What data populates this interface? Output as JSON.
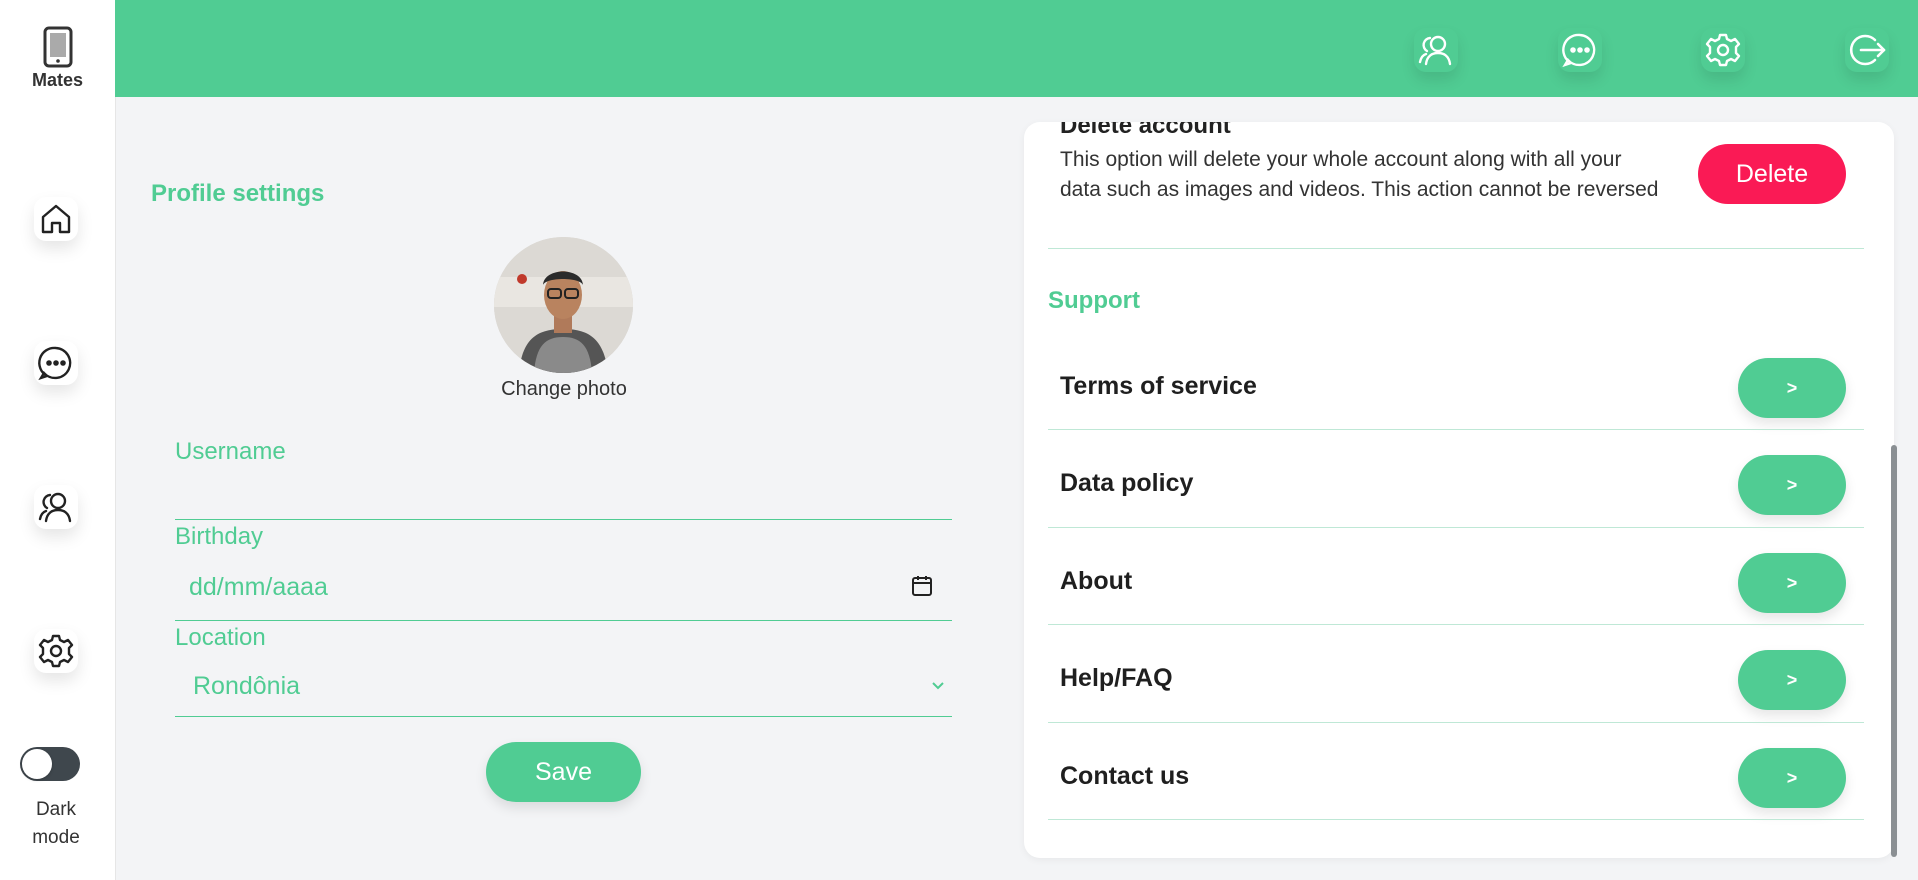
{
  "app": {
    "name": "Mates"
  },
  "sidebar": {
    "items": [
      {
        "icon": "home-icon"
      },
      {
        "icon": "chat-icon"
      },
      {
        "icon": "users-icon"
      },
      {
        "icon": "settings-icon"
      }
    ],
    "dark_mode": {
      "label": "Dark\nmode",
      "enabled": false
    }
  },
  "topbar": {
    "icons": [
      "users-icon",
      "chat-icon",
      "settings-icon",
      "logout-icon"
    ]
  },
  "profile": {
    "title": "Profile settings",
    "change_photo": "Change photo",
    "username": {
      "label": "Username",
      "value": ""
    },
    "birthday": {
      "label": "Birthday",
      "placeholder": "dd/mm/aaaa"
    },
    "location": {
      "label": "Location",
      "value": "Rondônia"
    },
    "save_label": "Save"
  },
  "danger": {
    "title": "Delete account",
    "description": "This option will delete your whole account along with all your data such as images and videos. This action cannot be reversed",
    "delete_label": "Delete"
  },
  "support": {
    "title": "Support",
    "items": [
      {
        "label": "Terms of service",
        "action": ">"
      },
      {
        "label": "Data policy",
        "action": ">"
      },
      {
        "label": "About",
        "action": ">"
      },
      {
        "label": "Help/FAQ",
        "action": ">"
      },
      {
        "label": "Contact us",
        "action": ">"
      }
    ]
  },
  "colors": {
    "accent": "#50cc93",
    "danger": "#fa1a55",
    "background": "#f3f4f6"
  }
}
